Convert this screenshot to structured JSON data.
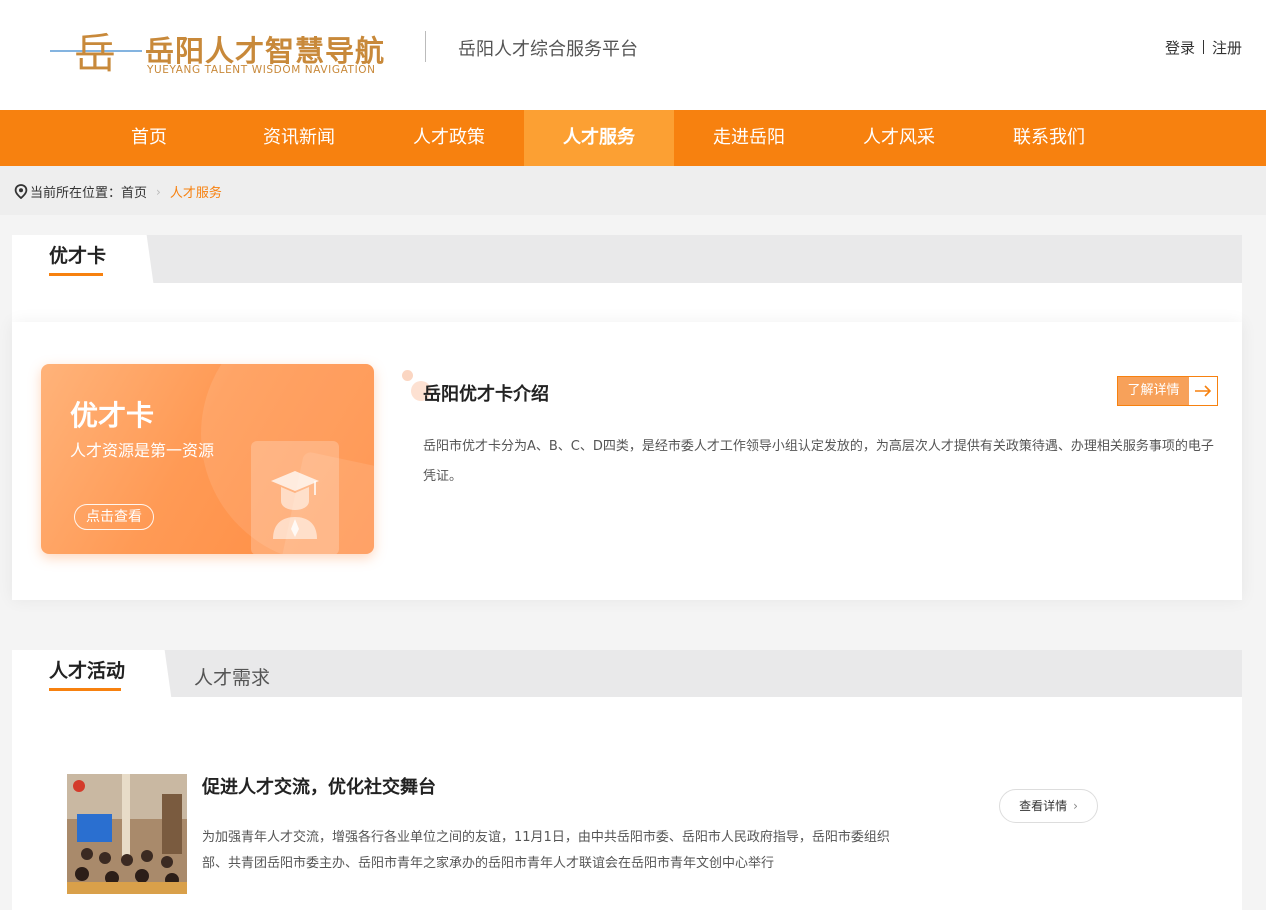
{
  "header": {
    "logo_mark": "岳",
    "logo_title": "岳阳人才智慧导航",
    "logo_subtitle": "YUEYANG TALENT WISDOM NAVIGATION",
    "platform_name": "岳阳人才综合服务平台",
    "login_label": "登录",
    "register_label": "注册"
  },
  "nav": {
    "items": [
      {
        "label": "首页"
      },
      {
        "label": "资讯新闻"
      },
      {
        "label": "人才政策"
      },
      {
        "label": "人才服务"
      },
      {
        "label": "走进岳阳"
      },
      {
        "label": "人才风采"
      },
      {
        "label": "联系我们"
      }
    ],
    "active_index": 3
  },
  "breadcrumb": {
    "prefix": "当前所在位置：",
    "home": "首页",
    "current": "人才服务"
  },
  "section1": {
    "tab_label": "优才卡",
    "card": {
      "title": "优才卡",
      "slogan": "人才资源是第一资源",
      "button_label": "点击查看"
    },
    "intro_title": "岳阳优才卡介绍",
    "more_label": "了解详情",
    "intro_text": "岳阳市优才卡分为A、B、C、D四类，是经市委人才工作领导小组认定发放的，为高层次人才提供有关政策待遇、办理相关服务事项的电子凭证。"
  },
  "section2": {
    "tabs": [
      {
        "label": "人才活动"
      },
      {
        "label": "人才需求"
      }
    ],
    "news": {
      "title": "促进人才交流，优化社交舞台",
      "description": "为加强青年人才交流，增强各行各业单位之间的友谊，11月1日，由中共岳阳市委、岳阳市人民政府指导，岳阳市委组织部、共青团岳阳市委主办、岳阳市青年之家承办的岳阳市青年人才联谊会在岳阳市青年文创中心举行",
      "button_label": "查看详情"
    }
  },
  "colors": {
    "primary": "#f7810f",
    "nav_active": "#fca033",
    "logo_gold": "#c8893a"
  }
}
